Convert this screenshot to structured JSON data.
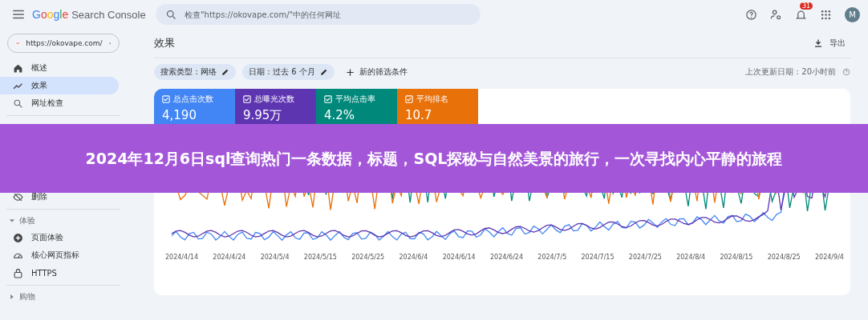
{
  "app": {
    "logo": "Google",
    "product": "Search Console"
  },
  "search": {
    "placeholder": "检查\"https://okovape.com/\"中的任何网址"
  },
  "topbar": {
    "notification_count": "31",
    "avatar": "M"
  },
  "property": {
    "url": "https://okovape.com/"
  },
  "sidebar": {
    "sections": [
      {
        "items": [
          {
            "label": "概述",
            "selected": false
          },
          {
            "label": "效果",
            "selected": true
          },
          {
            "label": "网址检查",
            "selected": false
          }
        ]
      },
      {
        "items": [
          {
            "label": "删除",
            "selected": false
          }
        ]
      },
      {
        "title": "体验",
        "expanded": true,
        "items": [
          {
            "label": "页面体验",
            "selected": false
          },
          {
            "label": "核心网页指标",
            "selected": false
          },
          {
            "label": "HTTPS",
            "selected": false
          }
        ]
      },
      {
        "title": "购物",
        "expanded": false
      }
    ]
  },
  "page": {
    "title": "效果",
    "export": "导出",
    "last_updated": "上次更新日期：20小时前"
  },
  "filters": [
    {
      "label": "搜索类型：网络",
      "kind": "chip"
    },
    {
      "label": "日期：过去 6 个月",
      "kind": "chip"
    },
    {
      "label": "新的筛选条件",
      "kind": "add"
    }
  ],
  "metrics": [
    {
      "label": "总点击次数",
      "value": "4,190",
      "checked": true,
      "color": "#4285f4"
    },
    {
      "label": "总曝光次数",
      "value": "9.95万",
      "checked": true,
      "color": "#5e35b1"
    },
    {
      "label": "平均点击率",
      "value": "4.2%",
      "checked": true,
      "color": "#00897b"
    },
    {
      "label": "平均排名",
      "value": "10.7",
      "checked": true,
      "color": "#e8710a"
    }
  ],
  "chart_x_labels": [
    "2024/4/14",
    "2024/4/24",
    "2024/5/4",
    "2024/5/15",
    "2024/5/25",
    "2024/6/4",
    "2024/6/14",
    "2024/6/24",
    "2024/7/5",
    "2024/7/15",
    "2024/7/25",
    "2024/8/4",
    "2024/8/15",
    "2024/8/25",
    "2024/9/4"
  ],
  "banner": {
    "title": "2024年12月6日sql查询热门一条数据，标题，SQL探秘与自然美景的旅行，一次寻找内心平静的旅程"
  }
}
